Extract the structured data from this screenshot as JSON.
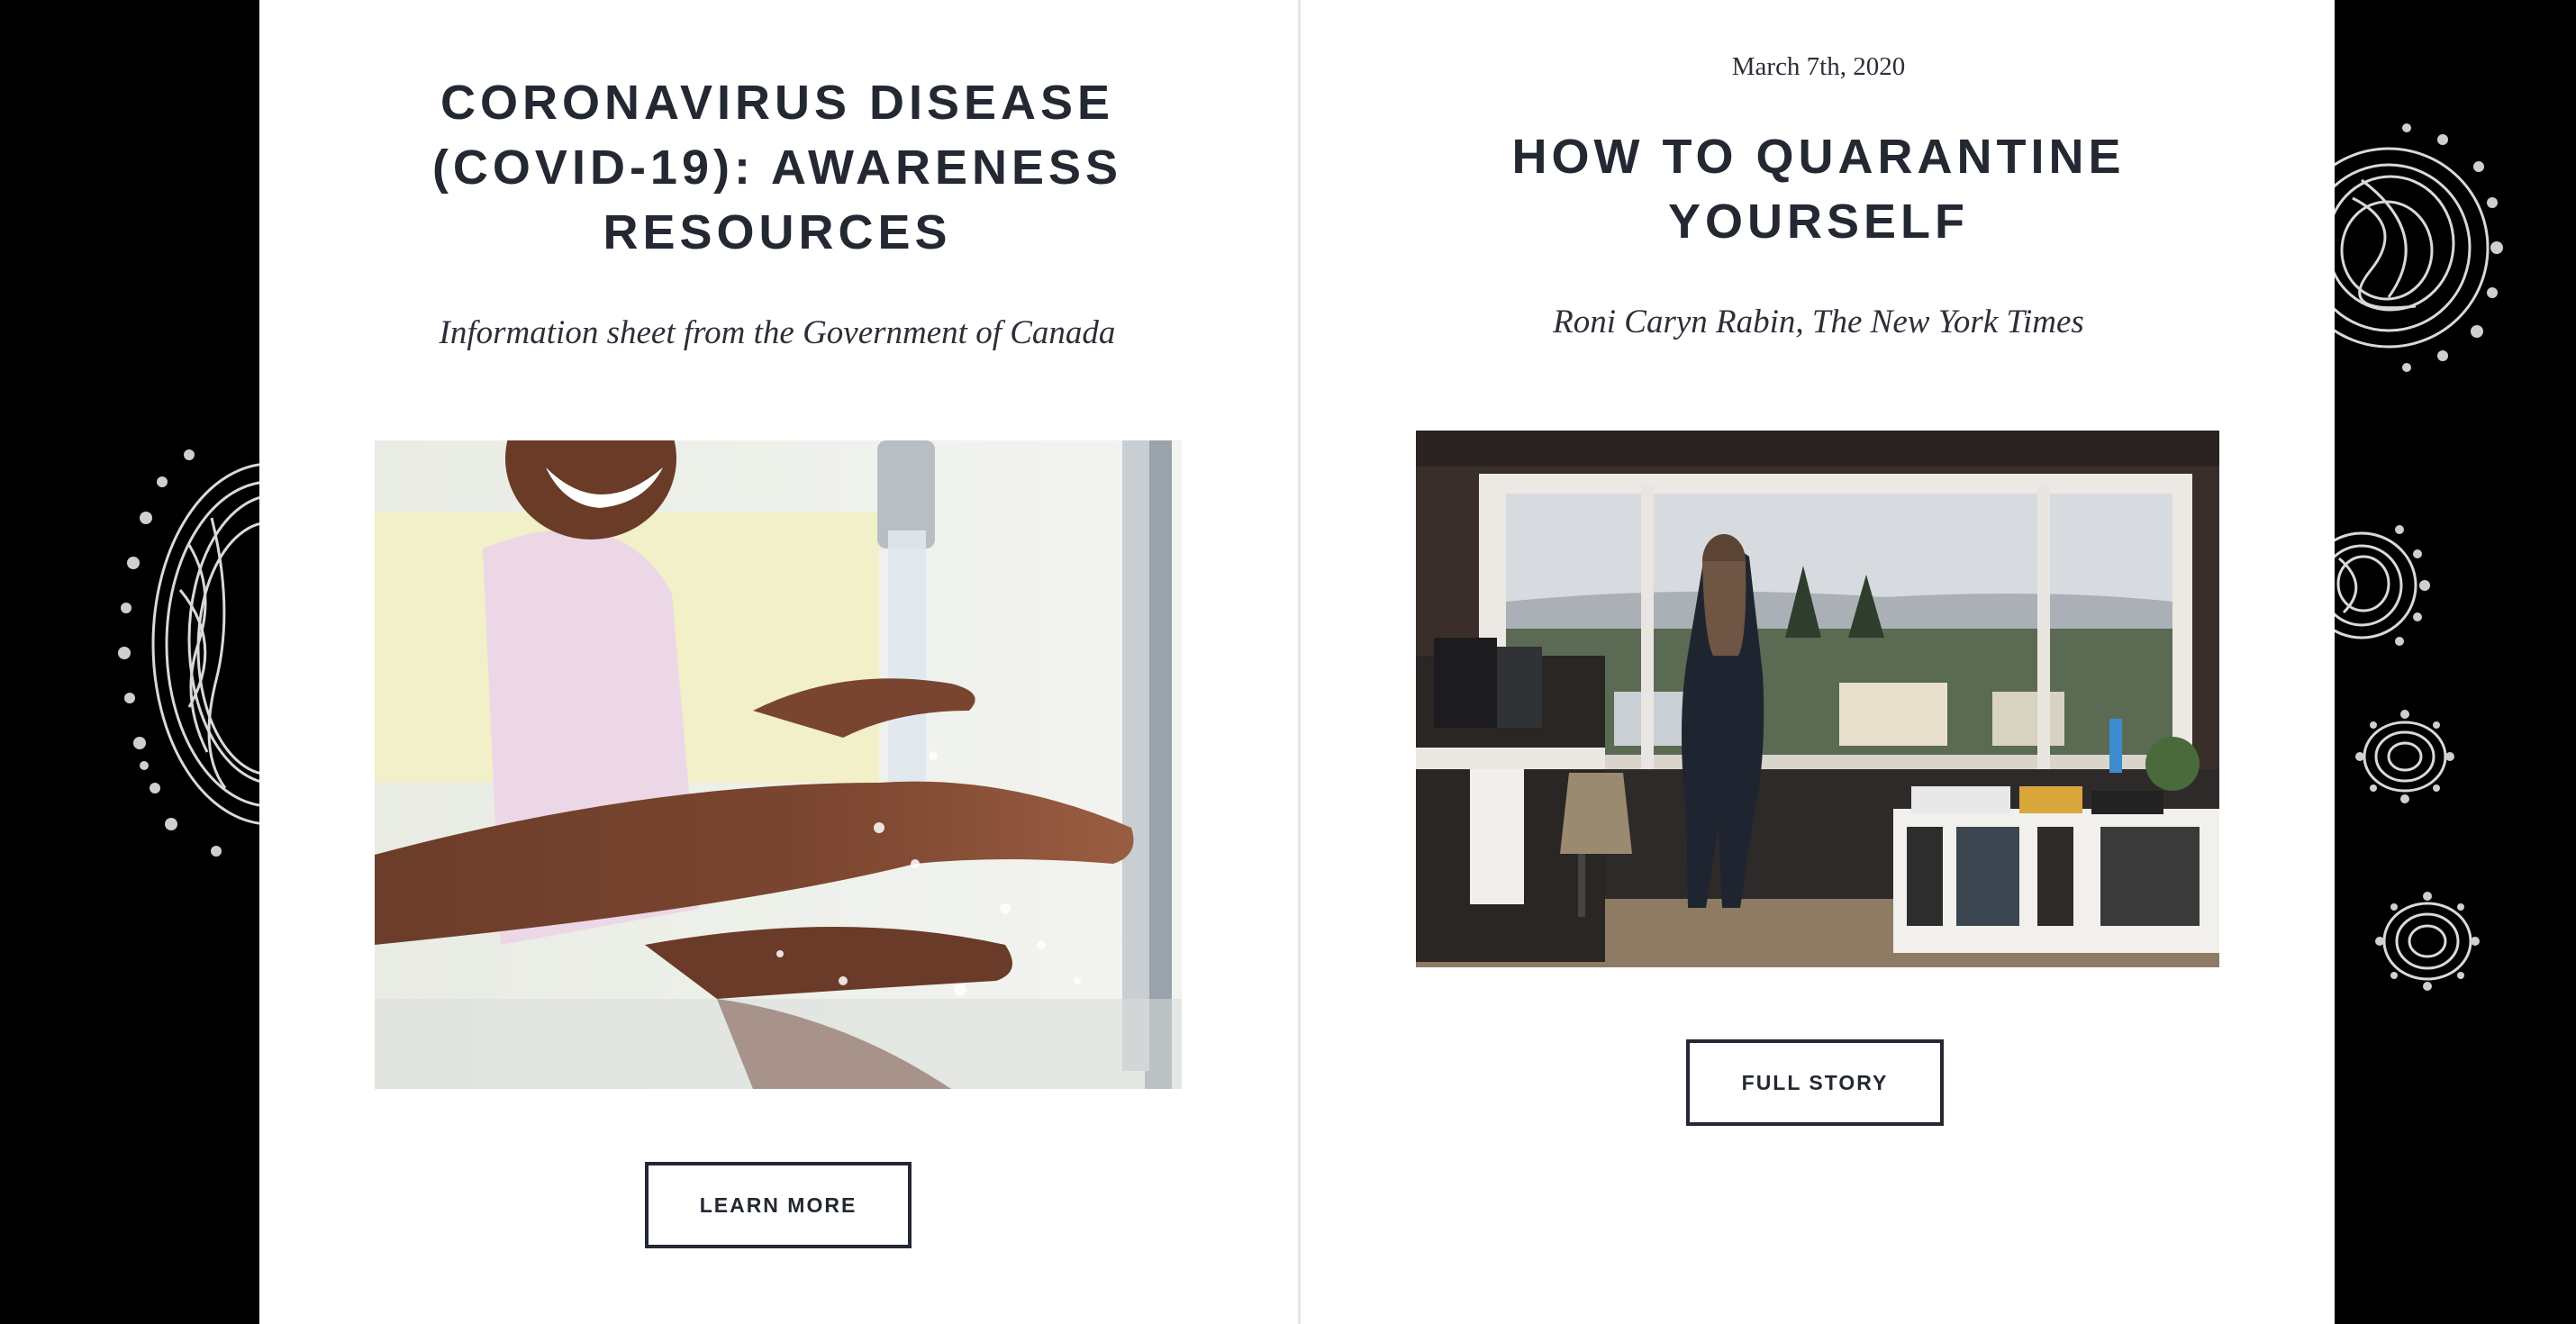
{
  "articles": [
    {
      "date": "",
      "title_lines": [
        "CORONAVIRUS DISEASE",
        "(COVID-19): AWARENESS",
        "RESOURCES"
      ],
      "subtitle": "Information sheet from the Government of Canada",
      "image_alt": "Child washing hands under a running faucet",
      "button_label": "LEARN MORE"
    },
    {
      "date": "March 7th, 2020",
      "title_lines": [
        "HOW TO QUARANTINE",
        "YOURSELF"
      ],
      "subtitle": "Roni Caryn Rabin, The New York Times",
      "image_alt": "Woman standing at a home office window looking out over a neighborhood",
      "button_label": "FULL STORY"
    }
  ],
  "colors": {
    "background": "#000000",
    "card": "#ffffff",
    "text": "#232833",
    "divider": "#e6e6e6"
  },
  "icons": [
    "virus-illustration"
  ]
}
